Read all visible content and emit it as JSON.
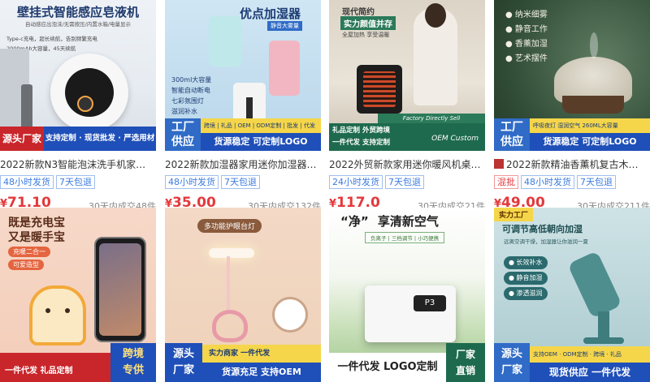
{
  "products": [
    {
      "title": "2022新款N3智能泡沫洗手机家…",
      "tags": [
        {
          "text": "48小时发货",
          "style": "blue"
        },
        {
          "text": "7天包退",
          "style": "blue"
        }
      ],
      "price": "71.10",
      "sold": "30天内成交48件",
      "image": {
        "headline": "壁挂式智能感应皂液机",
        "sub1": "自动感应出泡沫/无需按压/内置水箱/电量显示",
        "sub2": "Type-c充电，超长续航，告别频繁充电",
        "sub3": "2000mAh大容量，45天续航",
        "badge": "源头厂家",
        "banner": "支持定制 · 现货批发 · 严选用材"
      }
    },
    {
      "title": "2022新款加湿器家用迷你加湿器…",
      "tags": [
        {
          "text": "48小时发货",
          "style": "blue"
        },
        {
          "text": "7天包退",
          "style": "blue"
        }
      ],
      "price": "35.00",
      "sold": "30天内成交132件",
      "image": {
        "headline": "优点加湿器",
        "chip": "静音大雾量",
        "features": [
          "300ml大容量",
          "智能自动断电",
          "七彩氛围灯",
          "滋润补水"
        ],
        "badge_line1": "工厂",
        "badge_line2": "供应",
        "banner_top": "跨境 | 礼品 | OEM | ODM定制 | 批发 | 代发",
        "banner": "货源稳定  可定制LOGO"
      }
    },
    {
      "title": "2022外贸新款家用迷你暖风机桌…",
      "tags": [
        {
          "text": "24小时发货",
          "style": "blue"
        },
        {
          "text": "7天包退",
          "style": "blue"
        }
      ],
      "price": "117.0",
      "sold": "30天内成交21件",
      "image": {
        "headline1": "现代简约",
        "headline2": "实力颜值并存",
        "sub": "全屋加热 享受温暖",
        "banner_top": "Factory Directly Sell",
        "banner_left1": "礼品定制 外贸跨境",
        "banner_left2": "一件代发 支持定制",
        "banner_right": "OEM Custom"
      }
    },
    {
      "title": "2022新款精油香薰机复古木…",
      "tags": [
        {
          "text": "混批",
          "style": "red"
        },
        {
          "text": "48小时发货",
          "style": "blue"
        },
        {
          "text": "7天包退",
          "style": "blue"
        }
      ],
      "price": "49.00",
      "sold": "30天内成交211件",
      "image": {
        "features": [
          "纳米细雾",
          "静音工作",
          "香薰加湿",
          "艺术摆件"
        ],
        "badge_line1": "工厂",
        "badge_line2": "供应",
        "banner_top": "呼吸夜灯  湿润空气  260ML大容量",
        "banner": "货源稳定 可定制LOGO"
      }
    },
    {
      "image": {
        "headline1": "既是充电宝",
        "headline2": "又是暖手宝",
        "chip1": "充暖二合一",
        "chip2": "可爱造型",
        "banner_left": "一件代发 礼品定制",
        "banner_right1": "跨境",
        "banner_right2": "专供"
      }
    },
    {
      "image": {
        "headline": "多功能护眼台灯",
        "badge_line1": "源头",
        "badge_line2": "厂家",
        "banner_top": "实力商家 一件代发",
        "banner": "货源充足 支持OEM"
      }
    },
    {
      "image": {
        "headline1": "“净”",
        "headline2": "享清新空气",
        "sub": "负离子 | 三档调节 | 小巧便携",
        "display": "P3",
        "banner": "一件代发 LOGO定制",
        "badge_line1": "厂家",
        "badge_line2": "直销"
      }
    },
    {
      "image": {
        "corner": "实力工厂",
        "headline": "可调节高低朝向加湿",
        "sub": "远离空调干燥，加湿器让你滋润一夏",
        "features": [
          "长效补水",
          "静音加湿",
          "渗透滋润"
        ],
        "badge_line1": "源头",
        "badge_line2": "厂家",
        "banner_top": "支持OEM · ODM定制 · 跨境 · 礼品",
        "banner": "现货供应 一件代发"
      }
    }
  ],
  "currency": "¥",
  "colors": {
    "price": "#e4393c",
    "tag_blue": "#3b7be0",
    "banner_blue": "#1f4fb8",
    "banner_red": "#c9262b",
    "badge_orange": "#f09b2d"
  }
}
